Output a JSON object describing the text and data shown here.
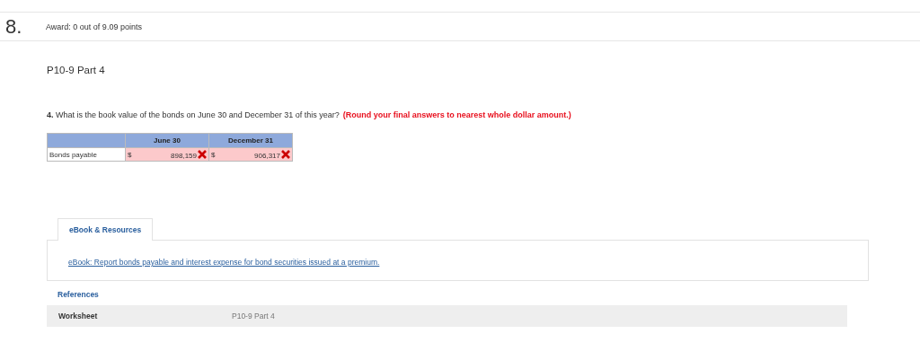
{
  "question_number": "8.",
  "award": "Award: 0 out of 9.09 points",
  "part_title": "P10-9 Part 4",
  "question": {
    "text": "**4.** What is the book value of the bonds on June 30 and December 31 of this year?",
    "note": "(Round your final answers to nearest whole dollar amount.)"
  },
  "table": {
    "columns": [
      "June 30",
      "December 31"
    ],
    "rows": [
      {
        "label": "Bonds payable",
        "cells": [
          {
            "currency": "$",
            "value": "898,159",
            "correct": false
          },
          {
            "currency": "$",
            "value": "906,317",
            "correct": false
          }
        ]
      }
    ]
  },
  "tabs": [
    {
      "label": "eBook & Resources",
      "selected": true
    }
  ],
  "resource_link": "eBook: Report bonds payable and interest expense for bond securities issued at a premium.",
  "references": {
    "title": "References",
    "rows": [
      {
        "label": "Worksheet",
        "value": "P10-9 Part 4"
      }
    ]
  }
}
